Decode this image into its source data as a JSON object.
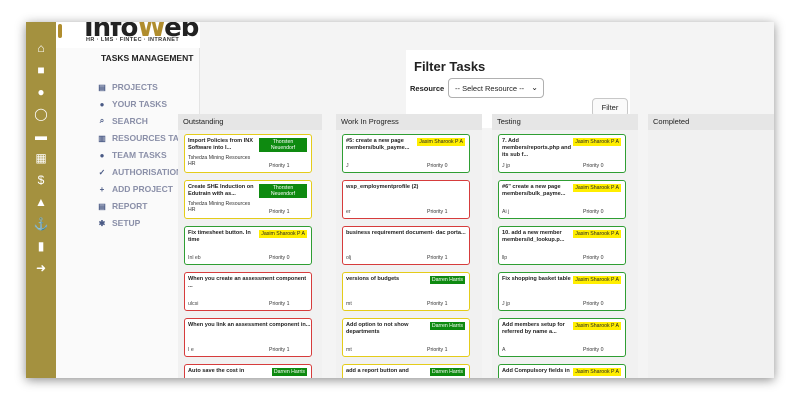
{
  "logo": {
    "wordmark_a": "Info",
    "wordmark_b": "W",
    "wordmark_c": "eb",
    "tagline": "HR · LMS · FINTEC · INTRANET"
  },
  "sidebar_icons": [
    "home-icon",
    "briefcase-icon",
    "users-icon",
    "chat-icon",
    "folder-icon",
    "calendar-icon",
    "dollar-icon",
    "graduation-icon",
    "anchor-icon",
    "lock-icon",
    "logout-icon"
  ],
  "menu": {
    "title": "TASKS MANAGEMENT",
    "items": [
      {
        "label": "PROJECTS",
        "icon": "document-icon"
      },
      {
        "label": "YOUR TASKS",
        "icon": "user-icon"
      },
      {
        "label": "SEARCH",
        "icon": "search-icon"
      },
      {
        "label": "RESOURCES TASK",
        "icon": "files-icon"
      },
      {
        "label": "TEAM TASKS",
        "icon": "team-icon"
      },
      {
        "label": "AUTHORISATION",
        "icon": "check-circle-icon"
      },
      {
        "label": "ADD PROJECT",
        "icon": "plus-square-icon"
      },
      {
        "label": "REPORT",
        "icon": "report-icon"
      },
      {
        "label": "SETUP",
        "icon": "gear-icon"
      }
    ]
  },
  "filter": {
    "title": "Filter Tasks",
    "resource_label": "Resource",
    "resource_selected": "-- Select Resource --",
    "button": "Filter"
  },
  "columns": [
    {
      "title": "Outstanding",
      "cards": [
        {
          "color": "yellow",
          "title": "Import Policies from INX Software into I...",
          "assignee": "Thorsten Neuendorf",
          "badge": "green",
          "sub1": "Tshedza Mining Resources",
          "sub2": "HR",
          "bottom": "",
          "priority": "Priority 1"
        },
        {
          "color": "yellow",
          "title": "Create SHE Induction on Edutrain with as...",
          "assignee": "Thorsten Neuendorf",
          "badge": "green",
          "sub1": "Tshedza Mining Resources",
          "sub2": "HR",
          "bottom": "",
          "priority": "Priority 1"
        },
        {
          "color": "green",
          "title": "Fix timesheet button. In time",
          "assignee": "Jasim Sharook P A",
          "badge": "yel",
          "sub1": "",
          "sub2": "",
          "bottom": "Inl    eb",
          "priority": "Priority 0"
        },
        {
          "color": "red",
          "title": "When you create an assessment component ...",
          "assignee": "",
          "badge": "",
          "sub1": "",
          "sub2": "",
          "bottom": "ulcsi",
          "priority": "Priority 1"
        },
        {
          "color": "red",
          "title": "When you link an assessment component in...",
          "assignee": "",
          "badge": "",
          "sub1": "",
          "sub2": "",
          "bottom": "I    e",
          "priority": "Priority 1"
        },
        {
          "color": "red",
          "title": "Auto save the cost in",
          "assignee": "Darren Harris",
          "badge": "green",
          "sub1": "",
          "sub2": "",
          "bottom": "",
          "priority": ""
        }
      ]
    },
    {
      "title": "Work In Progress",
      "cards": [
        {
          "color": "green",
          "title": "#5: create a new page members/bulk_payme...",
          "assignee": "Jasim Sharook P A",
          "badge": "yel",
          "sub1": "",
          "sub2": "",
          "bottom": "J",
          "priority": "Priority 0"
        },
        {
          "color": "red",
          "title": "wsp_employmentprofile (2)",
          "assignee": "",
          "badge": "",
          "sub1": "",
          "sub2": "",
          "bottom": "er",
          "priority": "Priority 1"
        },
        {
          "color": "red",
          "title": "business requirement document- dac porta...",
          "assignee": "",
          "badge": "",
          "sub1": "",
          "sub2": "",
          "bottom": "olj",
          "priority": "Priority 1"
        },
        {
          "color": "yellow",
          "title": "versions of budgets",
          "assignee": "Darren Harris",
          "badge": "green",
          "sub1": "",
          "sub2": "",
          "bottom": "mt",
          "priority": "Priority 1"
        },
        {
          "color": "yellow",
          "title": "Add option to not show departments",
          "assignee": "Darren Harris",
          "badge": "green",
          "sub1": "",
          "sub2": "",
          "bottom": "mt",
          "priority": "Priority 1"
        },
        {
          "color": "yellow",
          "title": "add a report button and",
          "assignee": "Darren Harris",
          "badge": "green",
          "sub1": "",
          "sub2": "",
          "bottom": "",
          "priority": ""
        }
      ]
    },
    {
      "title": "Testing",
      "cards": [
        {
          "color": "green",
          "title": "7. Add members/reports.php and its sub f...",
          "assignee": "Jasim Sharook P A",
          "badge": "yel",
          "sub1": "",
          "sub2": "",
          "bottom": "J    jp",
          "priority": "Priority 0"
        },
        {
          "color": "green",
          "title": "#6\" create a new page members/bulk_payme...",
          "assignee": "Jasim Sharook P A",
          "badge": "yel",
          "sub1": "",
          "sub2": "",
          "bottom": "Ai    j",
          "priority": "Priority 0"
        },
        {
          "color": "green",
          "title": "10. add a new member members/id_lookup.p...",
          "assignee": "Jasim Sharook P A",
          "badge": "yel",
          "sub1": "",
          "sub2": "",
          "bottom": "llp",
          "priority": "Priority 0"
        },
        {
          "color": "green",
          "title": "Fix shopping basket table",
          "assignee": "Jasim Sharook P A",
          "badge": "yel",
          "sub1": "",
          "sub2": "",
          "bottom": "J    jp",
          "priority": "Priority 0"
        },
        {
          "color": "green",
          "title": "Add members setup for referred by name a...",
          "assignee": "Jasim Sharook P A",
          "badge": "yel",
          "sub1": "",
          "sub2": "",
          "bottom": "A",
          "priority": "Priority 0"
        },
        {
          "color": "green",
          "title": "Add Compulsory fields in",
          "assignee": "Jasim Sharook P A",
          "badge": "yel",
          "sub1": "",
          "sub2": "",
          "bottom": "",
          "priority": ""
        }
      ]
    },
    {
      "title": "Completed",
      "cards": []
    }
  ]
}
